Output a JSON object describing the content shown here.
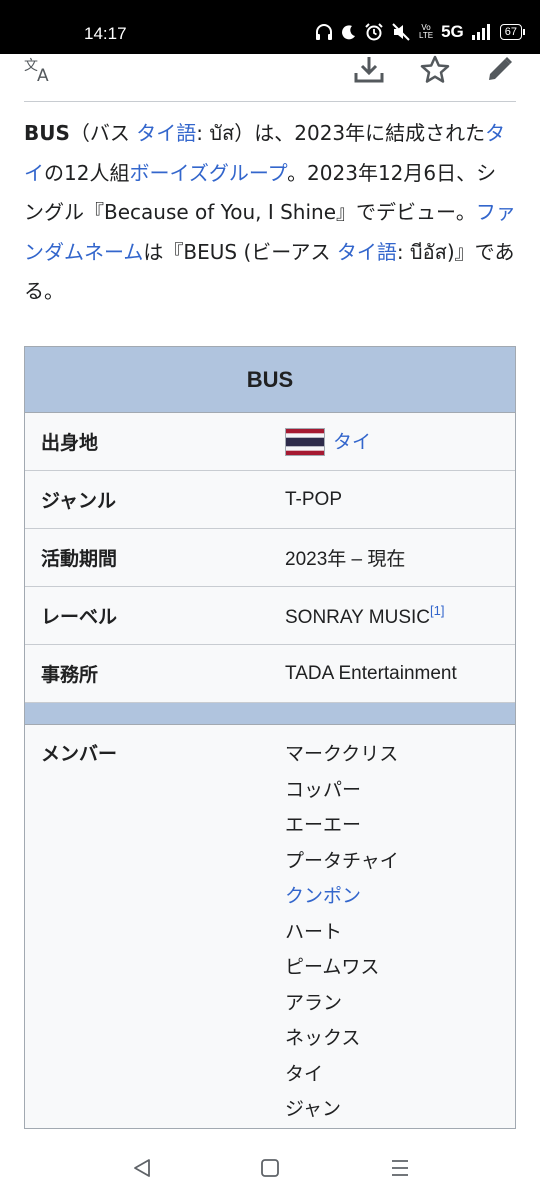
{
  "status_bar": {
    "time": "14:17",
    "network": "5G",
    "volte": "Vo LTE",
    "battery": "67"
  },
  "toolbar": {
    "icons": [
      "language-icon",
      "download-icon",
      "star-icon",
      "edit-icon"
    ]
  },
  "lead": {
    "title_bold": "BUS",
    "p1": "（バス ",
    "link_thai_lang": "タイ語",
    "p2": ": บัส）は、2023年に結成された",
    "link_thai": "タイ",
    "p3": "の12人組",
    "link_boys_group": "ボーイズグループ",
    "p4": "。2023年12月6日、シングル『Because of You, I Shine』でデビュー。",
    "link_fandom": "ファンダムネーム",
    "p5": "は『BEUS (ビーアス ",
    "link_thai_lang2": "タイ語",
    "p6": ": บีอัส)』である。"
  },
  "infobox": {
    "title": "BUS",
    "rows": [
      {
        "label": "出身地",
        "value": "タイ"
      },
      {
        "label": "ジャンル",
        "value": "T-POP"
      },
      {
        "label": "活動期間",
        "value": "2023年 – 現在"
      },
      {
        "label": "レーベル",
        "value": "SONRAY MUSIC",
        "ref": "[1]"
      },
      {
        "label": "事務所",
        "value": "TADA Entertainment"
      }
    ],
    "members_label": "メンバー",
    "members": [
      "マーククリス",
      "コッパー",
      "エーエー",
      "プータチャイ",
      "クンポン",
      "ハート",
      "ピームワス",
      "アラン",
      "ネックス",
      "タイ",
      "ジャン"
    ]
  },
  "colors": {
    "link": "#3366cc",
    "infobox_header": "#b0c4de",
    "text": "#202122"
  }
}
